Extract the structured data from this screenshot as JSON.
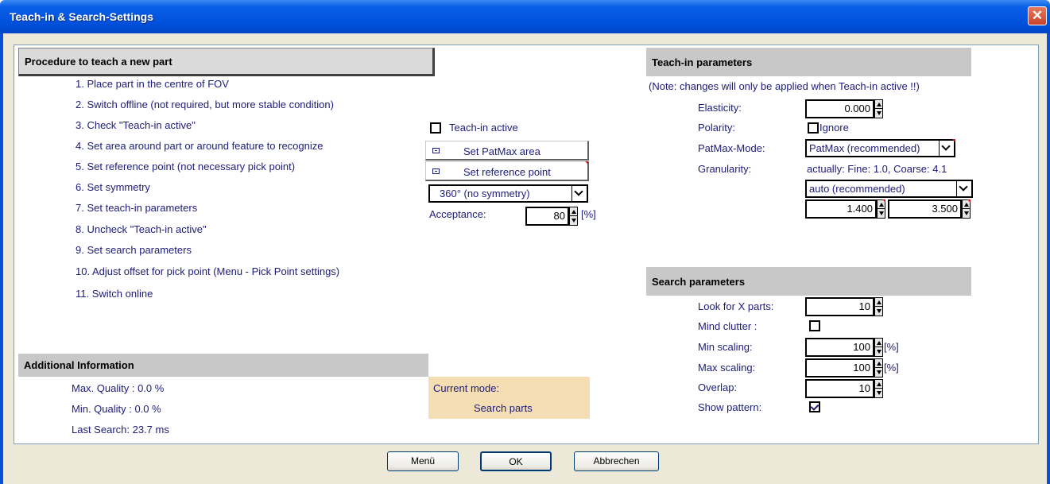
{
  "window": {
    "title": "Teach-in & Search-Settings",
    "close_label": "✕"
  },
  "procedure": {
    "header": "Procedure to teach a new part",
    "steps": [
      "1.  Place part in the centre of FOV",
      "2.  Switch offline (not required, but more stable condition)",
      "3.  Check \"Teach-in active\"",
      "4.  Set area around part or around feature to recognize",
      "5.  Set reference point (not necessary pick point)",
      "6.  Set symmetry",
      "7.  Set teach-in parameters",
      "8.  Uncheck \"Teach-in active\"",
      "9.  Set search parameters",
      "10. Adjust offset for pick point (Menu - Pick Point settings)",
      "11. Switch online"
    ]
  },
  "controls": {
    "teach_in_active_label": "Teach-in active",
    "teach_in_active_checked": false,
    "set_patmax_area": "Set PatMax area",
    "set_reference_point": "Set reference point",
    "symmetry_value": "360°  (no symmetry)",
    "acceptance_label": "Acceptance:",
    "acceptance_value": "80",
    "acceptance_unit": "[%]"
  },
  "additional": {
    "header": "Additional Information",
    "max_quality": "Max. Quality :  0.0  %",
    "min_quality": "Min. Quality :  0.0 %",
    "last_search": "Last Search:  23.7 ms"
  },
  "mode": {
    "label": "Current mode:",
    "value": "Search parts"
  },
  "teach_params": {
    "header": "Teach-in parameters",
    "note": "(Note: changes will only be applied when Teach-in active !!)",
    "elasticity_label": "Elasticity:",
    "elasticity_value": "0.000",
    "polarity_label": "Polarity:",
    "polarity_option": "Ignore",
    "polarity_checked": false,
    "patmax_mode_label": "PatMax-Mode:",
    "patmax_mode_value": "PatMax (recommended)",
    "granularity_label": "Granularity:",
    "granularity_actual": "actually: Fine: 1.0, Coarse: 4.1",
    "granularity_value": "auto (recommended)",
    "fine_value": "1.400",
    "coarse_value": "3.500"
  },
  "search_params": {
    "header": "Search parameters",
    "look_for_label": "Look for X parts:",
    "look_for_value": "10",
    "mind_clutter_label": "Mind clutter :",
    "mind_clutter_checked": false,
    "min_scaling_label": "Min scaling:",
    "min_scaling_value": "100",
    "max_scaling_label": "Max scaling:",
    "max_scaling_value": "100",
    "scaling_unit": "[%]",
    "overlap_label": "Overlap:",
    "overlap_value": "10",
    "show_pattern_label": "Show pattern:",
    "show_pattern_checked": true
  },
  "buttons": {
    "menu": "Menü",
    "ok": "OK",
    "cancel": "Abbrechen"
  }
}
